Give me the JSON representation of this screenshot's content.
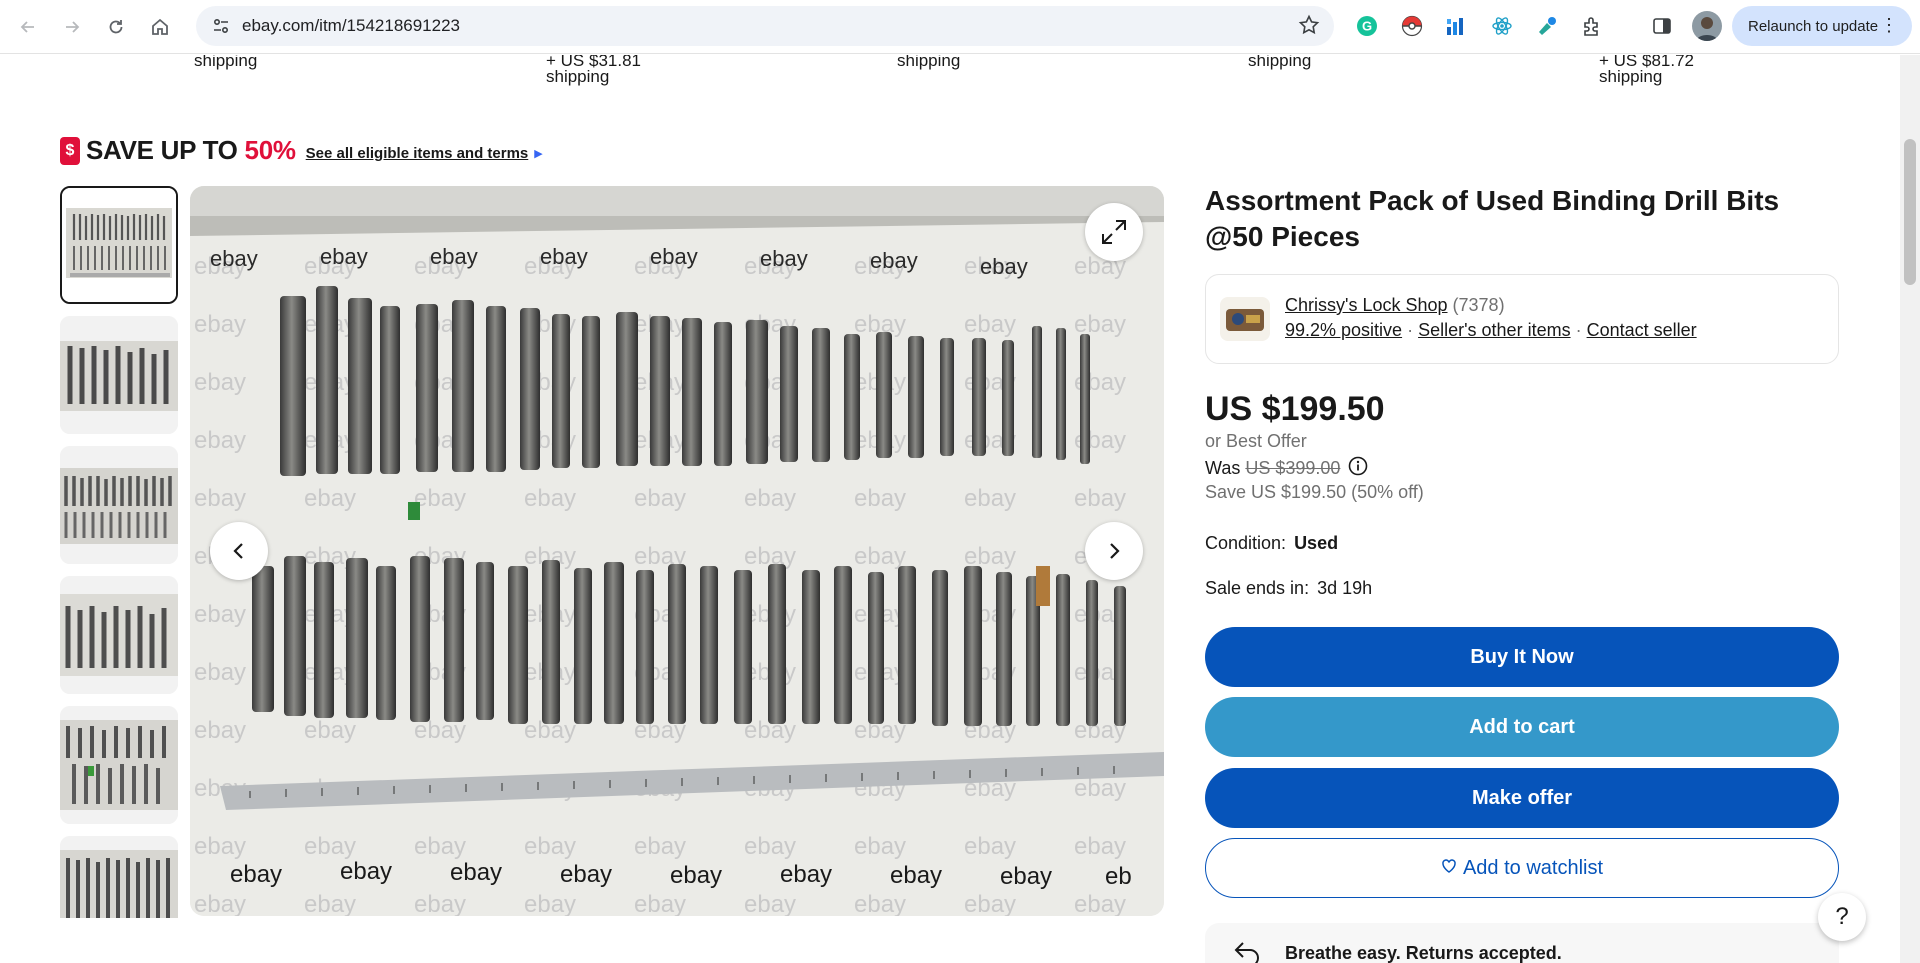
{
  "browser": {
    "url": "ebay.com/itm/154218691223",
    "relaunch_label": "Relaunch to update"
  },
  "shipping_row": [
    {
      "line1": "",
      "line2": "shipping"
    },
    {
      "line1": "+ US $31.81",
      "line2": "shipping"
    },
    {
      "line1": "",
      "line2": "shipping"
    },
    {
      "line1": "",
      "line2": "shipping"
    },
    {
      "line1": "+ US $81.72",
      "line2": "shipping"
    }
  ],
  "promo": {
    "save_prefix": "SAVE UP TO ",
    "save_pct": "50%",
    "tag_symbol": "$",
    "link": "See all eligible items and terms"
  },
  "listing": {
    "title": "Assortment Pack of Used Binding Drill Bits @50 Pieces",
    "seller": {
      "name": "Chrissy's Lock Shop",
      "feedback_count": "(7378)",
      "positive": "99.2% positive",
      "other_items": "Seller's other items",
      "contact": "Contact seller"
    },
    "price": "US $199.50",
    "best_offer": "or Best Offer",
    "was_label": "Was",
    "was_price": "US $399.00",
    "save": "Save US $199.50 (50% off)",
    "condition_label": "Condition:",
    "condition_value": "Used",
    "sale_ends_label": "Sale ends in:",
    "sale_ends_value": "3d 19h"
  },
  "actions": {
    "buy_now": "Buy It Now",
    "add_to_cart": "Add to cart",
    "make_offer": "Make offer",
    "watchlist": "Add to watchlist"
  },
  "returns": {
    "text": "Breathe easy. Returns accepted."
  },
  "help": "?",
  "colors": {
    "primary_blue": "#0654ba",
    "cart_blue": "#3498ca",
    "sale_red": "#e0103a"
  }
}
